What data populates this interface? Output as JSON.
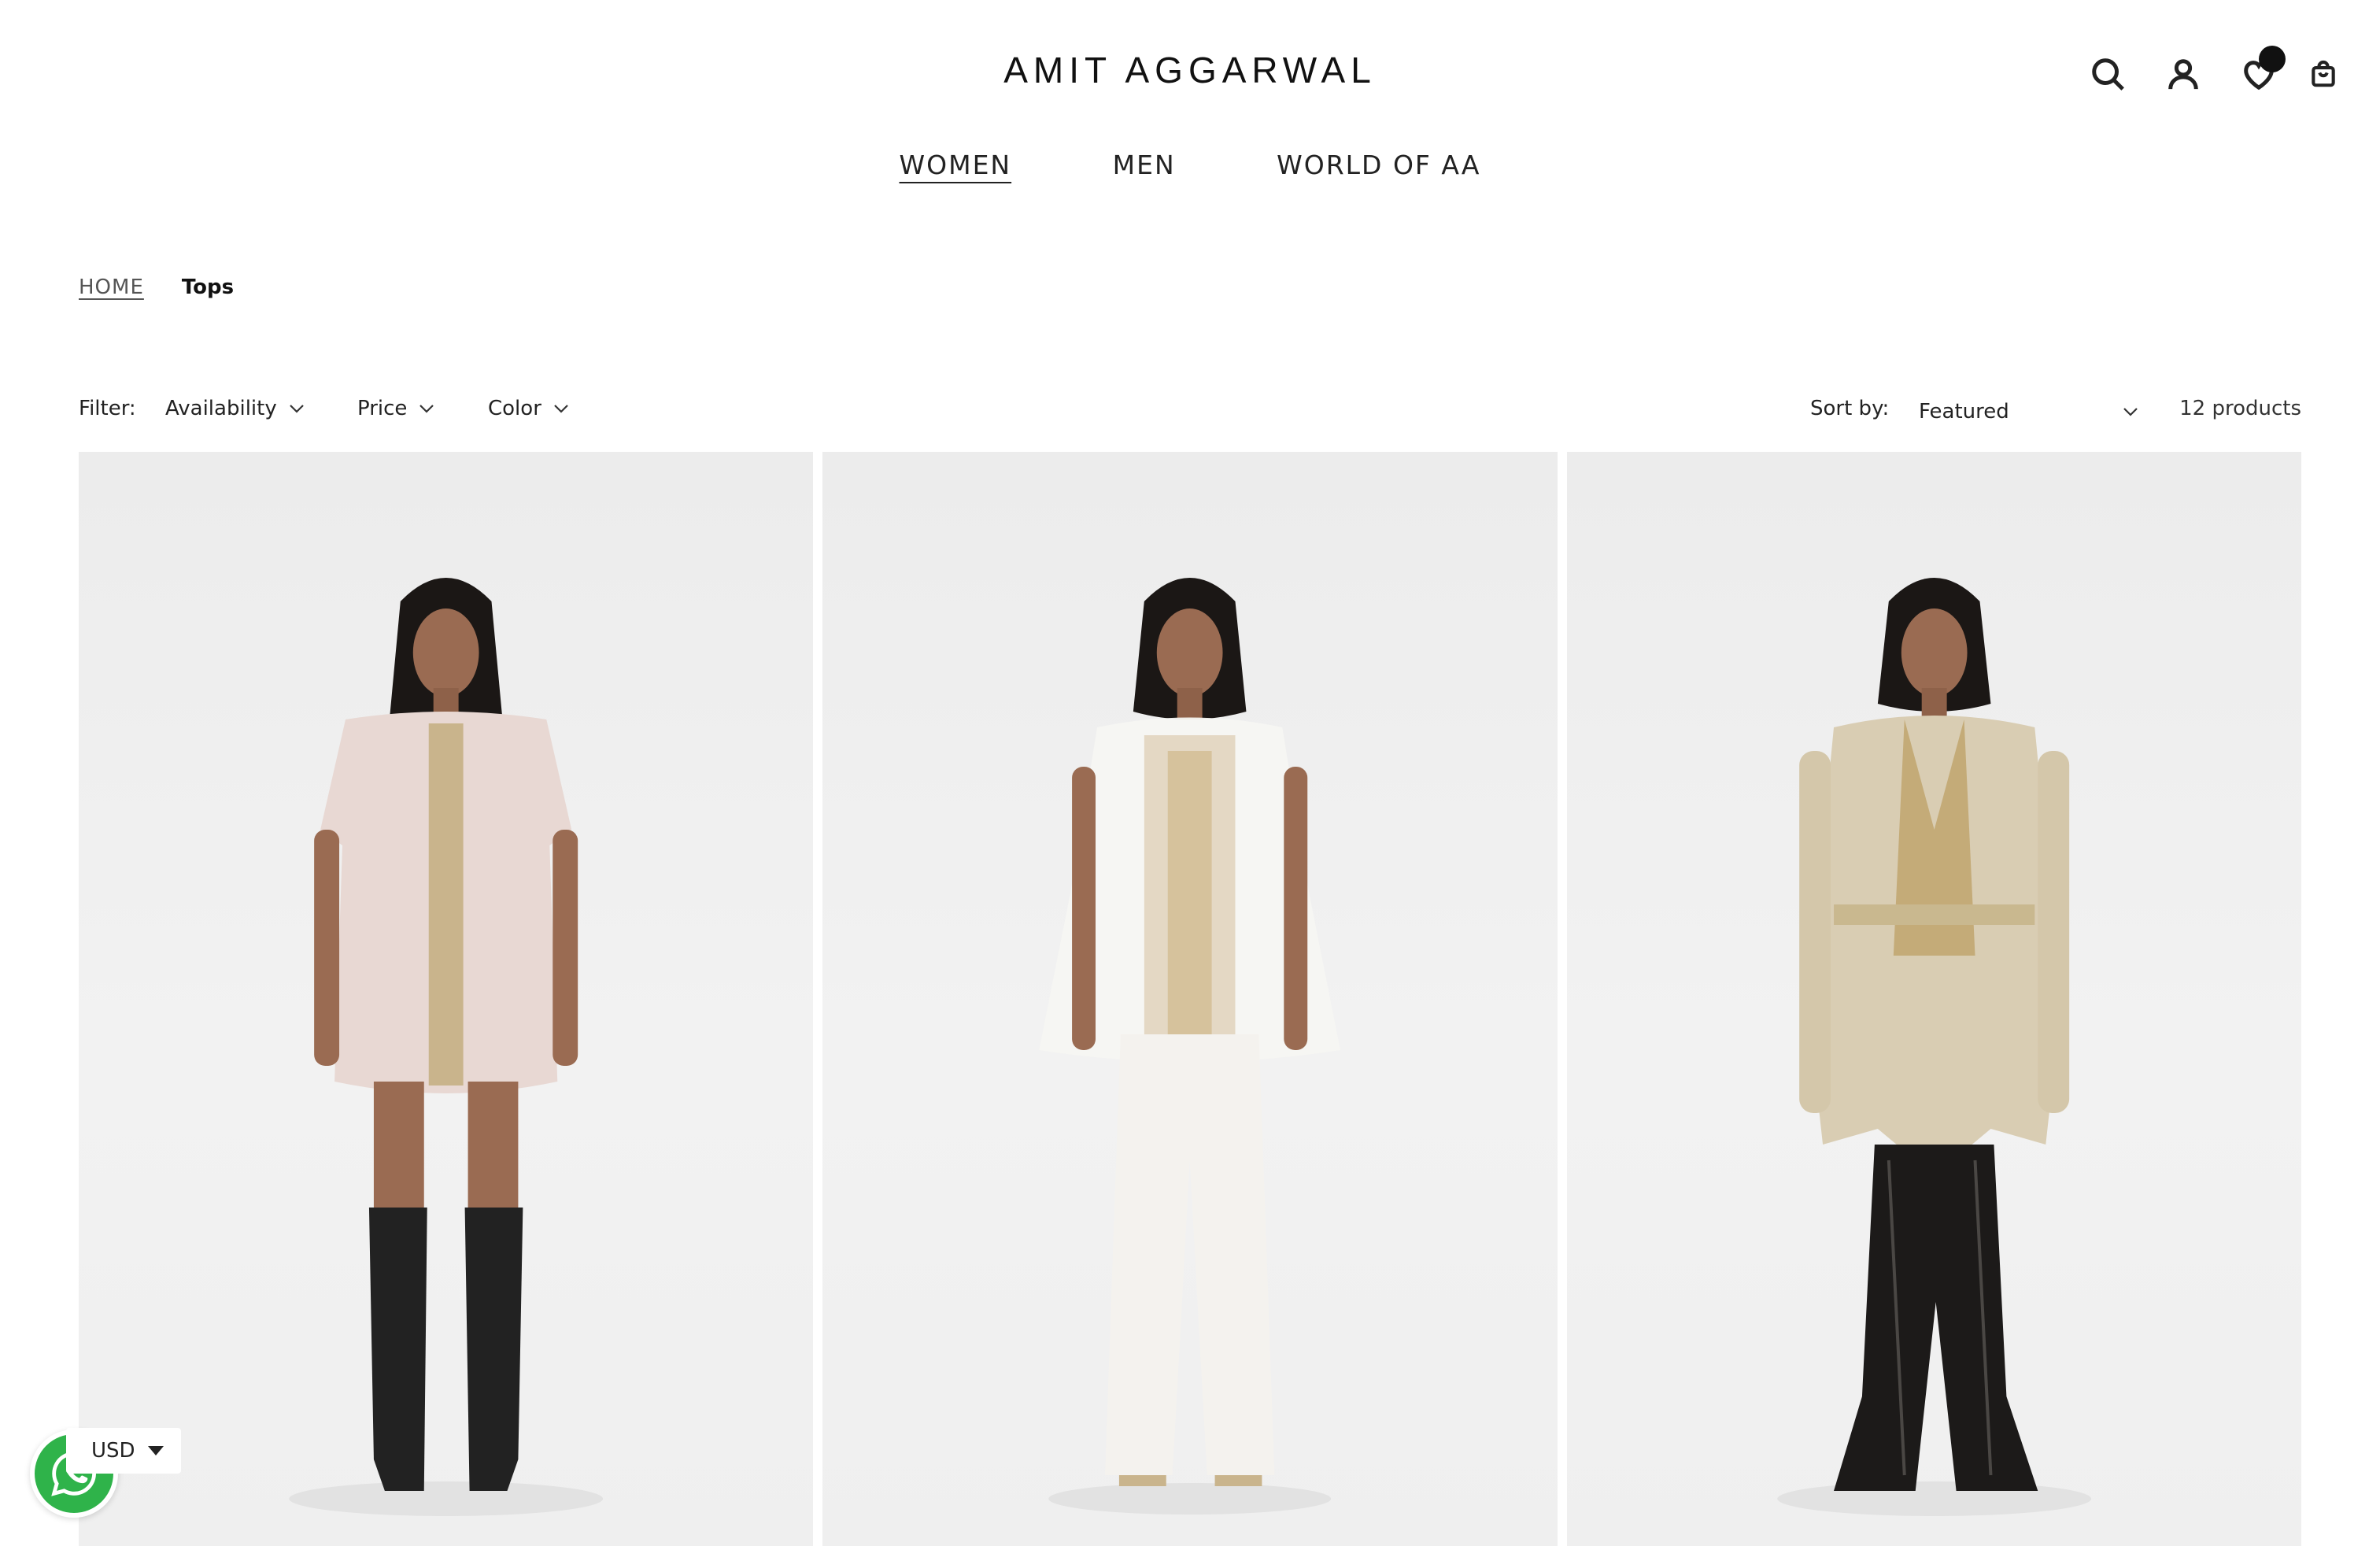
{
  "brand": {
    "logo": "AMIT AGGARWAL"
  },
  "header": {
    "icons": [
      "search-icon",
      "account-icon",
      "wishlist-icon",
      "cart-icon"
    ]
  },
  "nav": {
    "items": [
      {
        "label": "WOMEN",
        "active": true
      },
      {
        "label": "MEN",
        "active": false
      },
      {
        "label": "WORLD OF AA",
        "active": false
      }
    ]
  },
  "breadcrumb": {
    "home": "HOME",
    "current": "Tops"
  },
  "filters": {
    "label": "Filter:",
    "options": [
      "Availability",
      "Price",
      "Color"
    ],
    "sort_label": "Sort by:",
    "sort_value": "Featured",
    "product_count": "12 products"
  },
  "products": [
    {
      "garment": "blush-organza-shirt-dress"
    },
    {
      "garment": "ivory-sleeveless-cape-set"
    },
    {
      "garment": "gold-belted-jacket"
    }
  ],
  "currency": {
    "value": "USD"
  },
  "colors": {
    "text": "#1a1a1a",
    "whatsapp": "#2fb34a",
    "background": "#ffffff"
  }
}
